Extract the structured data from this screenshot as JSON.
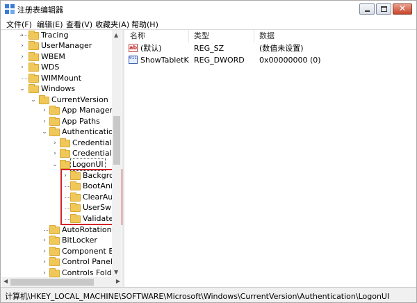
{
  "window": {
    "title": "注册表编辑器",
    "controls": {
      "minimize_icon": "minimize-icon",
      "maximize_icon": "maximize-icon",
      "close_icon": "close-icon",
      "close_glyph": "✕"
    }
  },
  "menu": [
    {
      "label": "文件(F)"
    },
    {
      "label": "编辑(E)"
    },
    {
      "label": "查看(V)"
    },
    {
      "label": "收藏夹(A)"
    },
    {
      "label": "帮助(H)"
    }
  ],
  "tree": {
    "expand_glyph": "›",
    "collapse_glyph": "⌄",
    "nodes": [
      {
        "label": "Tracing",
        "state": "collapsed"
      },
      {
        "label": "UserManager",
        "state": "collapsed"
      },
      {
        "label": "WBEM",
        "state": "collapsed"
      },
      {
        "label": "WDS",
        "state": "collapsed"
      },
      {
        "label": "WIMMount",
        "state": "leaf"
      },
      {
        "label": "Windows",
        "state": "expanded"
      },
      {
        "label": "CurrentVersion",
        "state": "expanded"
      },
      {
        "label": "App Manageme",
        "state": "collapsed"
      },
      {
        "label": "App Paths",
        "state": "collapsed"
      },
      {
        "label": "Authentication",
        "state": "expanded"
      },
      {
        "label": "Credential Pr",
        "state": "collapsed"
      },
      {
        "label": "Credential Pr",
        "state": "collapsed"
      },
      {
        "label": "LogonUI",
        "state": "expanded",
        "selected": true
      },
      {
        "label": "Backgrou",
        "state": "collapsed"
      },
      {
        "label": "BootAnim",
        "state": "leaf"
      },
      {
        "label": "ClearAuto",
        "state": "leaf"
      },
      {
        "label": "UserSwitc",
        "state": "leaf"
      },
      {
        "label": "ValidateU",
        "state": "leaf"
      },
      {
        "label": "AutoRotation",
        "state": "leaf"
      },
      {
        "label": "BitLocker",
        "state": "collapsed"
      },
      {
        "label": "Component Bas",
        "state": "collapsed"
      },
      {
        "label": "Control Panel",
        "state": "collapsed"
      },
      {
        "label": "Controls Folder",
        "state": "collapsed"
      }
    ],
    "scroll_up": "▲",
    "scroll_down": "▼",
    "scroll_left": "◀",
    "scroll_right": "▶"
  },
  "list": {
    "columns": [
      "名称",
      "类型",
      "数据"
    ],
    "rows": [
      {
        "name": "(默认)",
        "type": "REG_SZ",
        "data": "(数值未设置)",
        "icon": "string-value-icon",
        "icon_text": "ab"
      },
      {
        "name": "ShowTabletKe...",
        "type": "REG_DWORD",
        "data": "0x00000000 (0)",
        "icon": "binary-value-icon",
        "icon_text": "0110"
      }
    ]
  },
  "status": {
    "path": "计算机\\HKEY_LOCAL_MACHINE\\SOFTWARE\\Microsoft\\Windows\\CurrentVersion\\Authentication\\LogonUI"
  },
  "colors": {
    "highlight_border": "#d2232a",
    "folder": "#f0c85a"
  }
}
